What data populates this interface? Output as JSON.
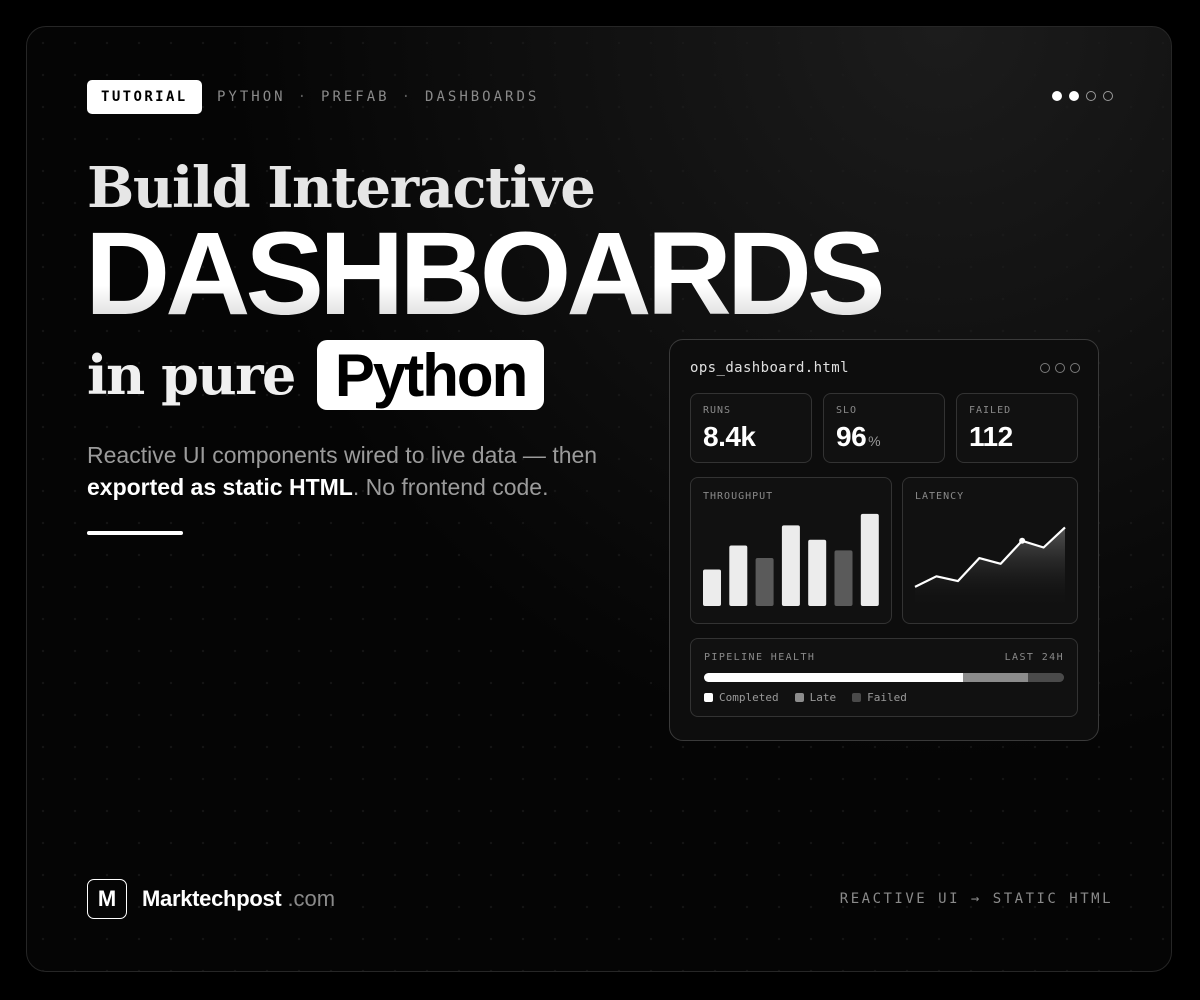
{
  "header": {
    "tag": "TUTORIAL",
    "crumbs": [
      "PYTHON",
      "PREFAB",
      "DASHBOARDS"
    ],
    "crumb_separator": "·",
    "pager": {
      "total": 4,
      "active": 2
    }
  },
  "headline": {
    "line1": "Build Interactive",
    "line2": "DASHBOARDS",
    "line3_prefix": "in pure",
    "line3_highlight": "Python"
  },
  "subtitle": {
    "part1": "Reactive UI components wired to live data — then ",
    "emphasis": "exported as static HTML",
    "part2": ". No frontend code."
  },
  "dashboard": {
    "title": "ops_dashboard.html",
    "stats": [
      {
        "label": "RUNS",
        "value": "8.4k",
        "unit": ""
      },
      {
        "label": "SLO",
        "value": "96",
        "unit": "%"
      },
      {
        "label": "FAILED",
        "value": "112",
        "unit": ""
      }
    ],
    "throughput": {
      "label": "THROUGHPUT",
      "values": [
        38,
        63,
        50,
        84,
        69,
        58,
        96
      ],
      "highlight": [
        true,
        true,
        false,
        true,
        true,
        false,
        true
      ]
    },
    "latency": {
      "label": "LATENCY",
      "values": [
        22,
        33,
        28,
        52,
        46,
        70,
        63,
        84
      ],
      "marker_index": 5
    },
    "pipeline": {
      "label": "PIPELINE HEALTH",
      "range": "LAST 24H",
      "segments": [
        {
          "label": "Completed",
          "fraction": 0.72,
          "color": "#ffffff"
        },
        {
          "label": "Late",
          "fraction": 0.18,
          "color": "#8c8c8c"
        },
        {
          "label": "Failed",
          "fraction": 0.1,
          "color": "#4a4a4a"
        }
      ]
    }
  },
  "footer": {
    "logo_letter": "M",
    "brand": "Marktechpost",
    "tld": ".com",
    "note": "REACTIVE UI → STATIC HTML"
  }
}
